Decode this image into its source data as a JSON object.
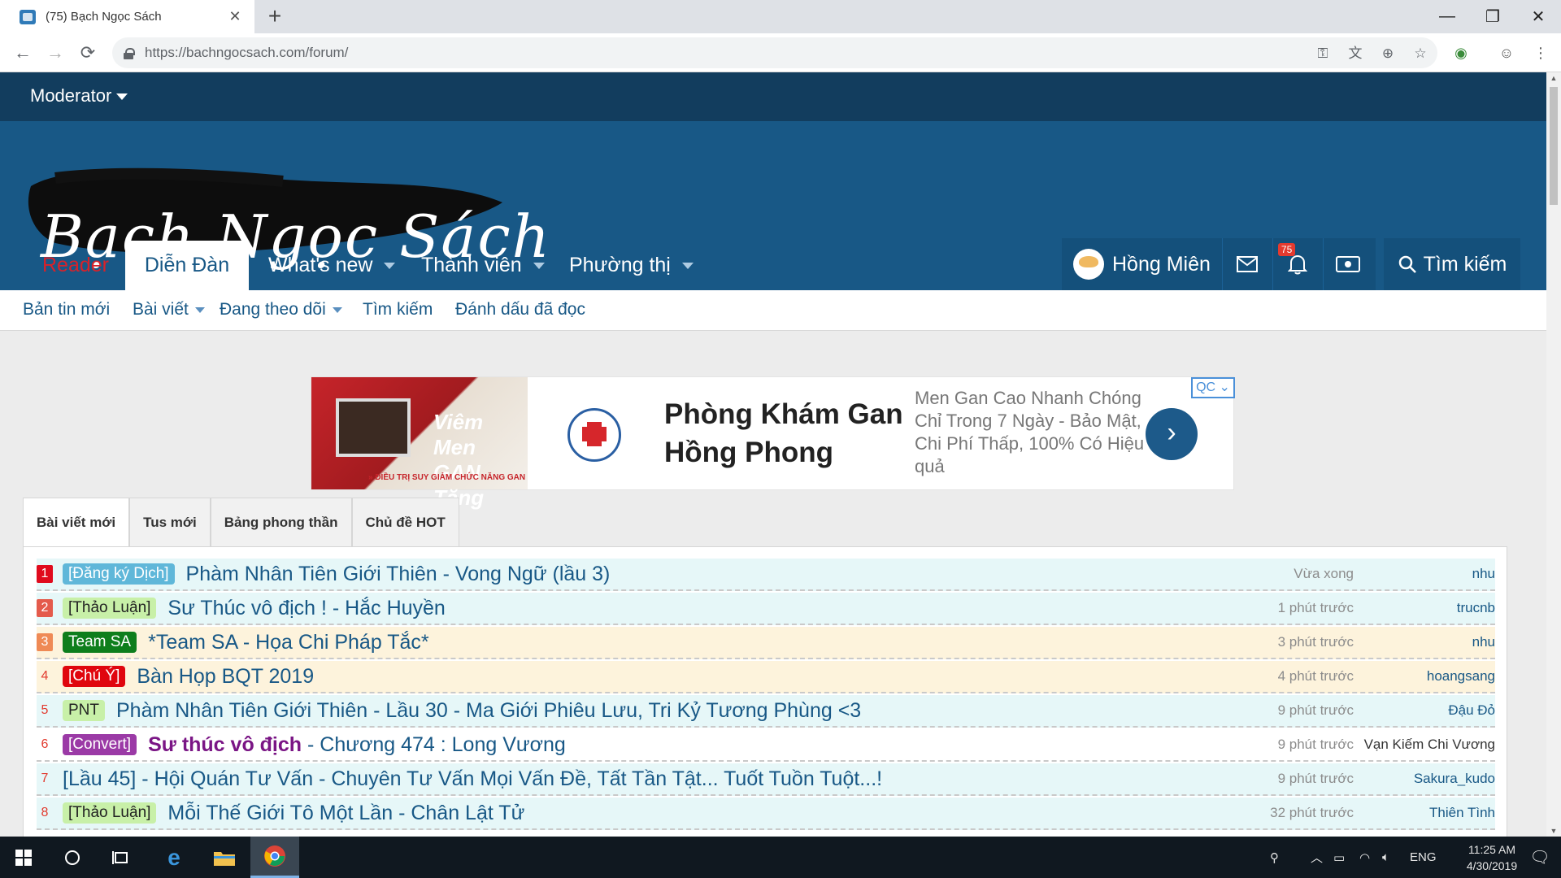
{
  "browser": {
    "tab_title": "(75) Bạch Ngọc Sách",
    "tab_close": "✕",
    "new_tab": "+",
    "url": "https://bachngocsach.com/forum/",
    "window": {
      "minimize": "—",
      "maximize": "❐",
      "close": "✕"
    },
    "nav": {
      "back": "←",
      "forward": "→",
      "reload": "⟳"
    },
    "icons": [
      "key-icon",
      "translate-icon",
      "zoom-icon",
      "star-icon",
      "extension-icon",
      "profile-icon",
      "menu-icon"
    ]
  },
  "site": {
    "moderator_label": "Moderator",
    "logo_text": "Bạch Ngọc Sách",
    "nav_tabs": [
      {
        "label": "Reader"
      },
      {
        "label": "Diễn Đàn"
      },
      {
        "label": "What's new"
      },
      {
        "label": "Thành viên"
      },
      {
        "label": "Phường thị"
      }
    ],
    "user_name": "Hồng Miên",
    "notification_count": "75",
    "search_label": "Tìm kiếm",
    "subnav": [
      {
        "label": "Bản tin mới"
      },
      {
        "label": "Bài viết"
      },
      {
        "label": "Đang theo dõi"
      },
      {
        "label": "Tìm kiếm"
      },
      {
        "label": "Đánh dấu đã đọc"
      }
    ]
  },
  "ad": {
    "image_text": "Viêm Men GAN Tăng",
    "image_footer": "» ĐIỀU TRỊ SUY GIẢM CHỨC NĂNG GAN",
    "title": "Phòng Khám Gan Hồng Phong",
    "description": "Men Gan Cao Nhanh Chóng Chỉ Trong 7 Ngày - Bảo Mật, Chi Phí Thấp, 100% Có Hiệu quả",
    "badge": "QC ⌄",
    "go": "›"
  },
  "list_tabs": [
    {
      "label": "Bài viết mới"
    },
    {
      "label": "Tus mới"
    },
    {
      "label": "Bảng phong thần"
    },
    {
      "label": "Chủ đề HOT"
    }
  ],
  "threads": [
    {
      "num": "1",
      "prefix": "[Đăng ký Dịch]",
      "title_bold": "",
      "title": "Phàm Nhân Tiên Giới Thiên - Vong Ngữ (lầu 3)",
      "time": "Vừa xong",
      "user": "nhu"
    },
    {
      "num": "2",
      "prefix": "[Thảo Luận]",
      "title_bold": "",
      "title": "Sư Thúc vô địch ! - Hắc Huyền",
      "time": "1 phút trước",
      "user": "trucnb"
    },
    {
      "num": "3",
      "prefix": "Team SA",
      "title_bold": "",
      "title": "*Team SA - Họa Chi Pháp Tắc*",
      "time": "3 phút trước",
      "user": "nhu"
    },
    {
      "num": "4",
      "prefix": "[Chú Ý]",
      "title_bold": "",
      "title": "Bàn Họp BQT 2019",
      "time": "4 phút trước",
      "user": "hoangsang"
    },
    {
      "num": "5",
      "prefix": "PNT",
      "title_bold": "",
      "title": "Phàm Nhân Tiên Giới Thiên - Lầu 30 - Ma Giới Phiêu Lưu, Tri Kỷ Tương Phùng <3",
      "time": "9 phút trước",
      "user": "Đậu Đỏ"
    },
    {
      "num": "6",
      "prefix": "[Convert]",
      "title_bold": "Sư thúc vô địch",
      "title": " - Chương 474 : Long Vương",
      "time": "9 phút trước",
      "user": "Vạn Kiếm Chi Vương"
    },
    {
      "num": "7",
      "prefix": "",
      "title_bold": "",
      "title": "[Lầu 45] - Hội Quán Tư Vấn - Chuyên Tư Vấn Mọi Vấn Đề, Tất Tần Tật... Tuốt Tuồn Tuột...!",
      "time": "9 phút trước",
      "user": "Sakura_kudo"
    },
    {
      "num": "8",
      "prefix": "[Thảo Luận]",
      "title_bold": "",
      "title": "Mỗi Thế Giới Tô Một Lần - Chân Lật Tử",
      "time": "32 phút trước",
      "user": "Thiên Tình"
    }
  ],
  "taskbar": {
    "lang": "ENG",
    "time": "11:25 AM",
    "date": "4/30/2019"
  },
  "colors": {
    "modbar": "#123d5e",
    "banner": "#185886",
    "link": "#185886",
    "reader": "#d8222a"
  }
}
